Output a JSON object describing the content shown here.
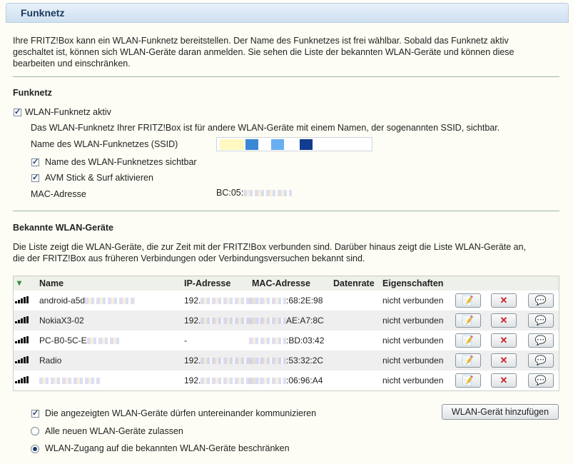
{
  "page": {
    "title": "Funknetz",
    "intro": [
      "Ihre FRITZ!Box kann ein WLAN-Funknetz bereitstellen. Der Name des Funknetzes ist frei wählbar. Sobald das Funknetz aktiv",
      "geschaltet ist, können sich WLAN-Geräte daran anmelden. Sie sehen die Liste der bekannten WLAN-Geräte und können diese",
      "bearbeiten und einschränken."
    ]
  },
  "funknetz": {
    "heading": "Funknetz",
    "wlan_active_label": "WLAN-Funknetz aktiv",
    "wlan_active_checked": true,
    "ssid_info": "Das WLAN-Funknetz Ihrer FRITZ!Box ist für andere WLAN-Geräte mit einem Namen, der sogenannten SSID, sichtbar.",
    "ssid_label": "Name des WLAN-Funknetzes (SSID)",
    "ssid_visible_label": "Name des WLAN-Funknetzes sichtbar",
    "ssid_visible_checked": true,
    "stick_surf_label": "AVM Stick & Surf aktivieren",
    "stick_surf_checked": true,
    "mac_label": "MAC-Adresse",
    "mac_value": "BC:05:"
  },
  "devices": {
    "heading": "Bekannte WLAN-Geräte",
    "intro": [
      "Die Liste zeigt die WLAN-Geräte, die zur Zeit mit der FRITZ!Box verbunden sind. Darüber hinaus zeigt die Liste WLAN-Geräte an,",
      "die der FRITZ!Box aus früheren Verbindungen oder Verbindungsversuchen bekannt sind."
    ],
    "columns": [
      "Name",
      "IP-Adresse",
      "MAC-Adresse",
      "Datenrate",
      "Eigenschaften"
    ],
    "rows": [
      {
        "name": "android-a5d",
        "ip": "192.",
        "mac": ":68:2E:98",
        "rate": "",
        "props": "nicht verbunden"
      },
      {
        "name": "NokiaX3-02",
        "ip": "192.",
        "mac": "AE:A7:8C",
        "rate": "",
        "props": "nicht verbunden"
      },
      {
        "name": "PC-B0-5C-E",
        "ip": "-",
        "mac": ":BD:03:42",
        "rate": "",
        "props": "nicht verbunden"
      },
      {
        "name": "Radio",
        "ip": "192.",
        "mac": ":53:32:2C",
        "rate": "",
        "props": "nicht verbunden"
      },
      {
        "name": "",
        "ip": "192.",
        "mac": ":06:96:A4",
        "rate": "",
        "props": "nicht verbunden"
      }
    ],
    "edit_icon": "edit-icon",
    "delete_icon": "delete-icon",
    "info_icon": "message-icon"
  },
  "options": {
    "communicate_label": "Die angezeigten WLAN-Geräte dürfen untereinander kommunizieren",
    "communicate_checked": true,
    "allow_all_label": "Alle neuen WLAN-Geräte zulassen",
    "restrict_label": "WLAN-Zugang auf die bekannten WLAN-Geräte beschränken",
    "selected": "restrict",
    "add_button": "WLAN-Gerät hinzufügen"
  },
  "colors": {
    "header": "#cfe0f0",
    "accent": "#1c3d6d",
    "delete": "#cc2222"
  }
}
